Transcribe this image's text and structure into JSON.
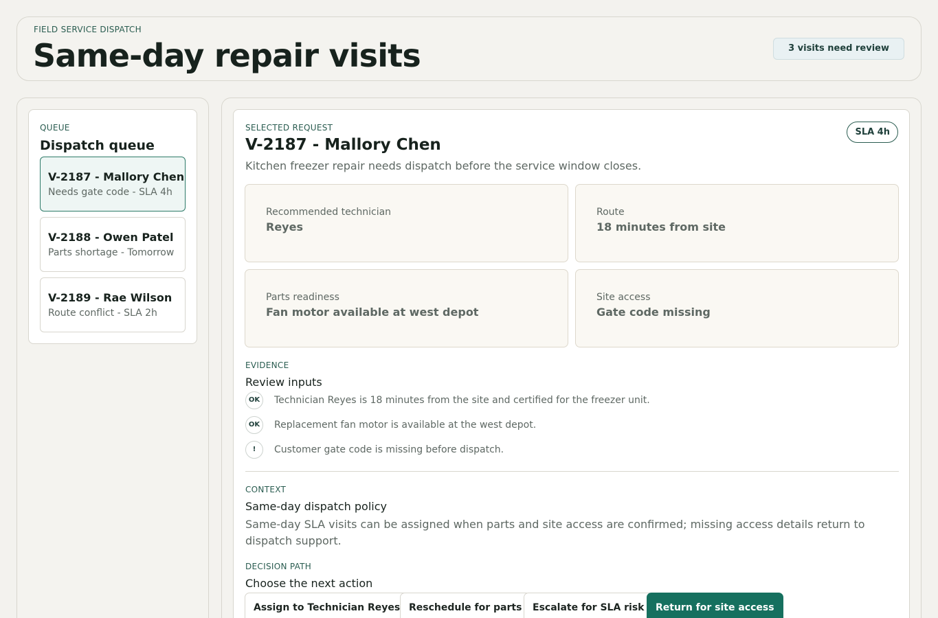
{
  "header": {
    "eyebrow": "FIELD SERVICE DISPATCH",
    "title": "Same-day repair visits",
    "review_badge": "3 visits need review"
  },
  "queue": {
    "eyebrow": "QUEUE",
    "title": "Dispatch queue",
    "items": [
      {
        "title": "V-2187 - Mallory Chen",
        "subtitle": "Needs gate code - SLA 4h",
        "selected": true
      },
      {
        "title": "V-2188 - Owen Patel",
        "subtitle": "Parts shortage - Tomorrow",
        "selected": false
      },
      {
        "title": "V-2189 - Rae Wilson",
        "subtitle": "Route conflict - SLA 2h",
        "selected": false
      }
    ]
  },
  "request": {
    "eyebrow": "SELECTED REQUEST",
    "title": "V-2187 - Mallory Chen",
    "description": "Kitchen freezer repair needs dispatch before the service window closes.",
    "sla_chip": "SLA 4h",
    "tiles": [
      {
        "label": "Recommended technician",
        "value": "Reyes"
      },
      {
        "label": "Route",
        "value": "18 minutes from site"
      },
      {
        "label": "Parts readiness",
        "value": "Fan motor available at west depot"
      },
      {
        "label": "Site access",
        "value": "Gate code missing"
      }
    ]
  },
  "evidence": {
    "eyebrow": "EVIDENCE",
    "heading": "Review inputs",
    "items": [
      {
        "badge": "OK",
        "text": "Technician Reyes is 18 minutes from the site and certified for the freezer unit."
      },
      {
        "badge": "OK",
        "text": "Replacement fan motor is available at the west depot."
      },
      {
        "badge": "!",
        "text": "Customer gate code is missing before dispatch."
      }
    ]
  },
  "context": {
    "eyebrow": "CONTEXT",
    "heading": "Same-day dispatch policy",
    "text": "Same-day SLA visits can be assigned when parts and site access are confirmed; missing access details return to dispatch support."
  },
  "decision": {
    "eyebrow": "DECISION PATH",
    "heading": "Choose the next action",
    "actions": [
      {
        "label": "Assign to Technician Reyes",
        "primary": false
      },
      {
        "label": "Reschedule for parts",
        "primary": false
      },
      {
        "label": "Escalate for SLA risk",
        "primary": false
      },
      {
        "label": "Return for site access",
        "primary": true
      }
    ]
  },
  "colors": {
    "accent": "#16705f",
    "selected_bg": "#eef6f4",
    "page_bg": "#f3f2ee"
  }
}
